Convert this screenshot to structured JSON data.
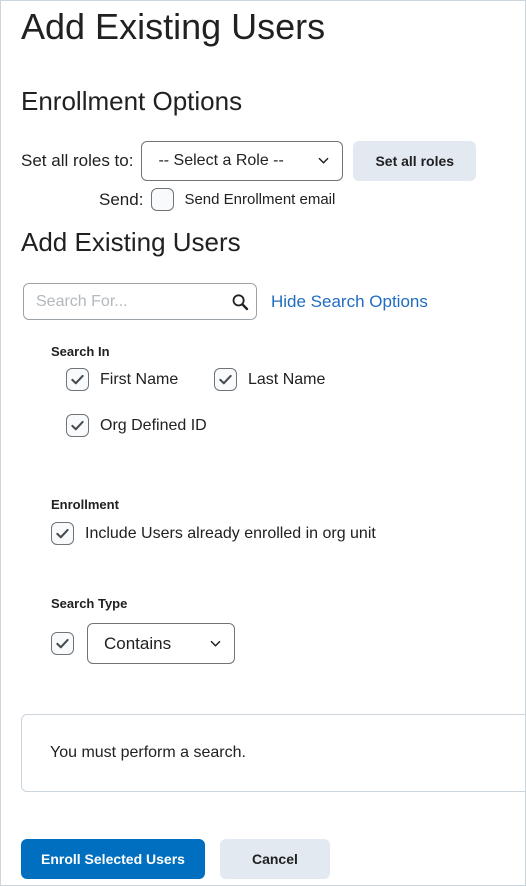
{
  "page": {
    "title": "Add Existing Users"
  },
  "enrollment_options": {
    "heading": "Enrollment Options",
    "set_roles_label": "Set all roles to:",
    "role_select": {
      "value": "-- Select a Role --",
      "options": [
        "-- Select a Role --"
      ]
    },
    "set_all_roles_button": "Set all roles",
    "send_label": "Send:",
    "send_email_checkbox": {
      "label": "Send Enrollment email",
      "checked": false
    }
  },
  "add_existing_users": {
    "heading": "Add Existing Users",
    "search": {
      "placeholder": "Search For...",
      "value": "",
      "search_icon": "magnifier-icon",
      "toggle_link": "Hide Search Options"
    },
    "search_in": {
      "label": "Search In",
      "options": [
        {
          "label": "First Name",
          "checked": true
        },
        {
          "label": "Last Name",
          "checked": true
        },
        {
          "label": "Org Defined ID",
          "checked": true
        }
      ]
    },
    "enrollment": {
      "label": "Enrollment",
      "options": [
        {
          "label": "Include Users already enrolled in org unit",
          "checked": true
        }
      ]
    },
    "search_type": {
      "label": "Search Type",
      "enabled": true,
      "select": {
        "value": "Contains",
        "options": [
          "Contains"
        ]
      }
    },
    "results": {
      "message": "You must perform a search."
    }
  },
  "footer": {
    "primary_button": "Enroll Selected Users",
    "cancel_button": "Cancel"
  },
  "colors": {
    "primary": "#006fbf",
    "secondary_bg": "#e3e9f1",
    "link": "#1f6dc0",
    "text": "#202122",
    "border": "#cdd5dc",
    "placeholder": "#b3b8bc"
  }
}
